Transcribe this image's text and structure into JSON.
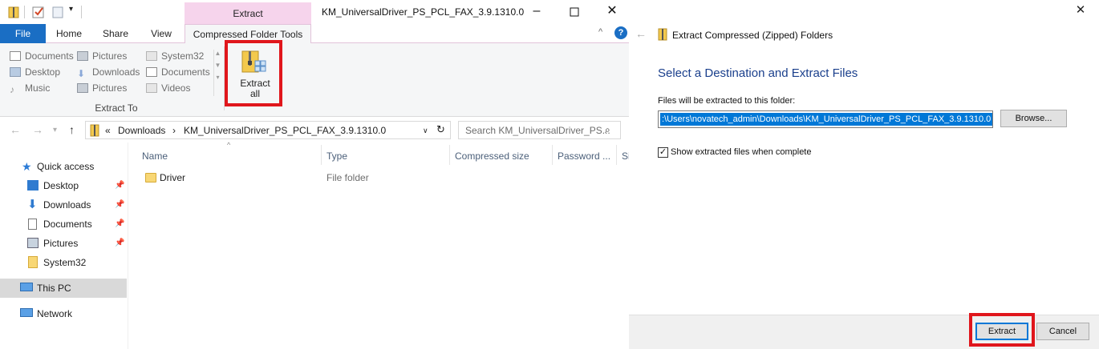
{
  "explorer": {
    "window_title": "KM_UniversalDriver_PS_PCL_FAX_3.9.1310.0",
    "context_tab_label": "Extract",
    "tabs": [
      {
        "label": "File"
      },
      {
        "label": "Home"
      },
      {
        "label": "Share"
      },
      {
        "label": "View"
      },
      {
        "label": "Compressed Folder Tools"
      }
    ],
    "ribbon": {
      "extract_to_items": [
        {
          "label": "Documents",
          "icon": "documents-icon"
        },
        {
          "label": "Desktop",
          "icon": "desktop-icon"
        },
        {
          "label": "Music",
          "icon": "music-icon"
        },
        {
          "label": "Pictures",
          "icon": "pictures-icon"
        },
        {
          "label": "Downloads",
          "icon": "downloads-icon"
        },
        {
          "label": "Pictures",
          "icon": "pictures-icon"
        },
        {
          "label": "System32",
          "icon": "folder-icon"
        },
        {
          "label": "Documents",
          "icon": "documents-icon"
        },
        {
          "label": "Videos",
          "icon": "videos-icon"
        }
      ],
      "extract_to_group_label": "Extract To",
      "extract_all_label": "Extract\nall"
    },
    "address": {
      "prefix": "«",
      "crumbs": [
        "Downloads",
        "KM_UniversalDriver_PS_PCL_FAX_3.9.1310.0"
      ]
    },
    "search_placeholder": "Search KM_UniversalDriver_PS...",
    "nav": {
      "quick_access": "Quick access",
      "items": [
        {
          "label": "Desktop",
          "pinned": true
        },
        {
          "label": "Downloads",
          "pinned": true
        },
        {
          "label": "Documents",
          "pinned": true
        },
        {
          "label": "Pictures",
          "pinned": true
        },
        {
          "label": "System32",
          "pinned": false
        }
      ],
      "this_pc": "This PC",
      "network": "Network"
    },
    "columns": [
      "Name",
      "Type",
      "Compressed size",
      "Password ...",
      "Si"
    ],
    "rows": [
      {
        "name": "Driver",
        "type": "File folder"
      }
    ]
  },
  "dialog": {
    "title": "Extract Compressed (Zipped) Folders",
    "heading": "Select a Destination and Extract Files",
    "label": "Files will be extracted to this folder:",
    "path": ":\\Users\\novatech_admin\\Downloads\\KM_UniversalDriver_PS_PCL_FAX_3.9.1310.0",
    "browse_label": "Browse...",
    "checkbox_label": "Show extracted files when complete",
    "checkbox_checked": true,
    "extract_label": "Extract",
    "cancel_label": "Cancel"
  },
  "colors": {
    "file_tab": "#1a6ec4",
    "context_tab": "#f6d4ec",
    "highlight_box": "#e0161c",
    "dialog_heading": "#1a3f8c",
    "selection": "#0078d7"
  }
}
